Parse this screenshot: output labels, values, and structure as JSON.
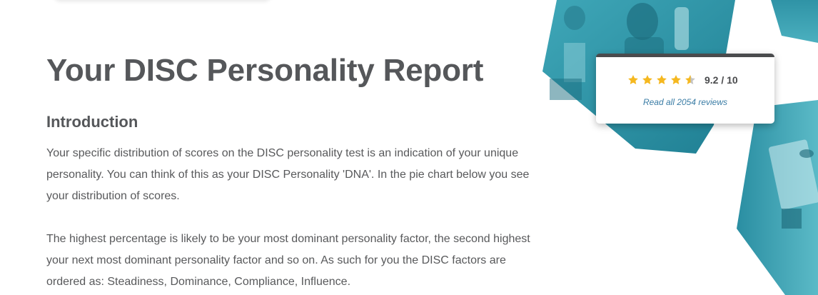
{
  "report": {
    "title": "Your DISC Personality Report"
  },
  "introduction": {
    "heading": "Introduction",
    "paragraph1": "Your specific distribution of scores on the DISC personality test is an indication of your unique personality. You can think of this as your DISC Personality 'DNA'. In the pie chart below you see your distribution of scores.",
    "paragraph2": "The highest percentage is likely to be your most dominant personality factor, the second highest your next most dominant personality factor and so on. As such for you the DISC factors are ordered as: Steadiness, Dominance, Compliance, Influence."
  },
  "rating": {
    "score": "9.2 / 10",
    "stars_value": 4.6,
    "stars_max": 5,
    "reviews_link": "Read all 2054 reviews",
    "star_color": "#f5b820",
    "star_empty_color": "#c4c4c4"
  },
  "colors": {
    "heading": "#55575a",
    "body_text": "#58595b",
    "link": "#3a7ca5",
    "accent_teal": "#2e95a8"
  },
  "icons": {
    "star": "star-icon",
    "half_star": "star-half-icon"
  }
}
